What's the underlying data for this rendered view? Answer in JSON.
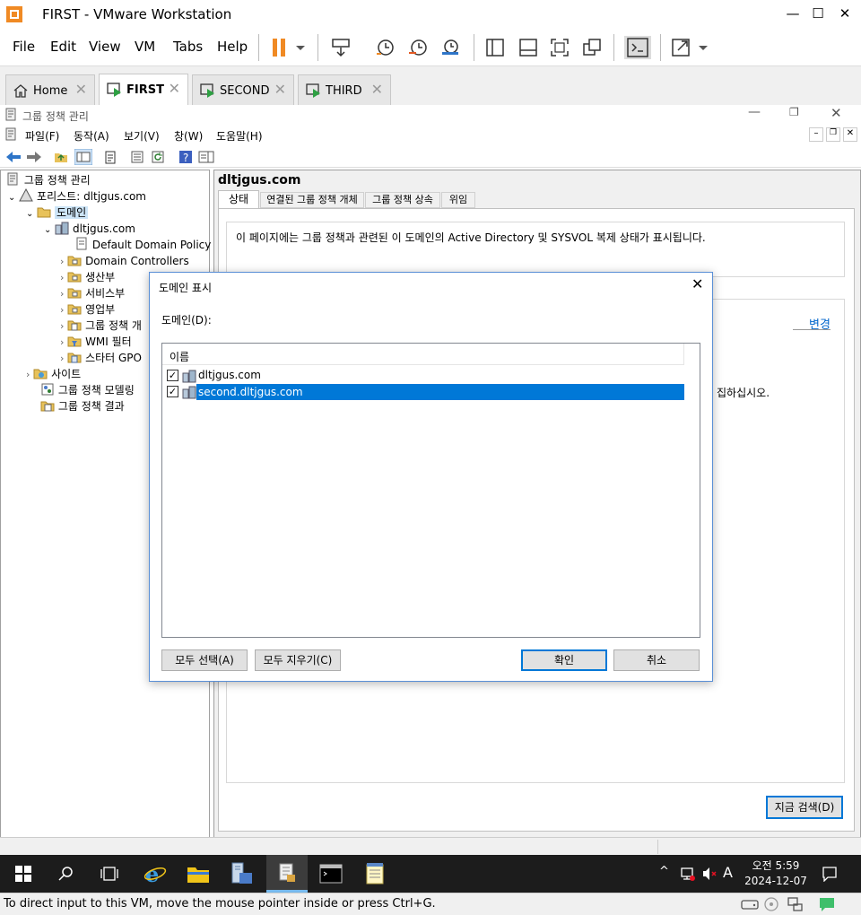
{
  "vm": {
    "title": "FIRST - VMware Workstation",
    "menu": [
      "File",
      "Edit",
      "View",
      "VM",
      "Tabs",
      "Help"
    ],
    "tabs": [
      {
        "label": "Home",
        "active": false
      },
      {
        "label": "FIRST",
        "active": true
      },
      {
        "label": "SECOND",
        "active": false
      },
      {
        "label": "THIRD",
        "active": false
      }
    ],
    "status_hint": "To direct input to this VM, move the mouse pointer inside or press Ctrl+G."
  },
  "mmc": {
    "title": "그룹 정책 관리",
    "menu": [
      "파일(F)",
      "동작(A)",
      "보기(V)",
      "창(W)",
      "도움말(H)"
    ]
  },
  "tree": {
    "root": "그룹 정책 관리",
    "forest": "포리스트: dltjgus.com",
    "domains": "도메인",
    "domain": "dltjgus.com",
    "items": [
      "Default Domain Policy",
      "Domain Controllers",
      "생산부",
      "서비스부",
      "영업부",
      "그룹 정책 개",
      "WMI 필터",
      "스타터 GPO"
    ],
    "sites": "사이트",
    "modeling": "그룹 정책 모델링",
    "results": "그룹 정책 결과"
  },
  "right": {
    "heading": "dltjgus.com",
    "tabs": [
      "상태",
      "연결된 그룹 정책 개체",
      "그룹 정책 상속",
      "위임"
    ],
    "info": "이 페이지에는 그룹 정책과 관련된 이 도메인의 Active Directory 및 SYSVOL 복제 상태가 표시됩니다.",
    "change_link": "변경",
    "partial_text": "집하십시오.",
    "search_button": "지금 검색(D)"
  },
  "dialog": {
    "title": "도메인 표시",
    "label": "도메인(D):",
    "column": "이름",
    "rows": [
      {
        "name": "dltjgus.com",
        "checked": true,
        "selected": false
      },
      {
        "name": "second.dltjgus.com",
        "checked": true,
        "selected": true
      }
    ],
    "select_all": "모두 선택(A)",
    "clear_all": "모두 지우기(C)",
    "ok": "확인",
    "cancel": "취소"
  },
  "taskbar": {
    "ime": "A",
    "time": "오전 5:59",
    "date": "2024-12-07"
  },
  "colors": {
    "selection": "#0078d7",
    "accent": "#f08a24",
    "link": "#0066cc"
  }
}
